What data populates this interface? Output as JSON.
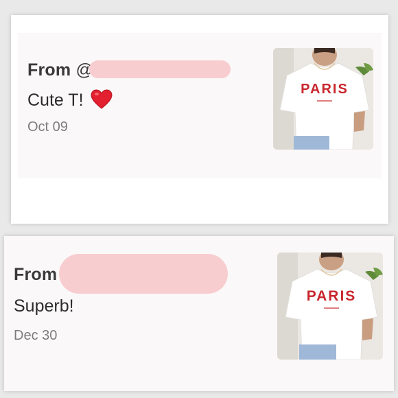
{
  "reviews": [
    {
      "from_label": "From",
      "handle_visible": "@",
      "message": "Cute T!",
      "emoji": "heart-emoji",
      "date": "Oct 09",
      "image": {
        "shirt_text": "PARIS",
        "shirt_color": "#ffffff",
        "text_color": "#c8262c"
      }
    },
    {
      "from_label": "From",
      "message": "Superb!",
      "date": "Dec 30",
      "image": {
        "shirt_text": "PARIS",
        "shirt_color": "#ffffff",
        "text_color": "#c8262c"
      }
    }
  ],
  "colors": {
    "mask": "#f8cdd0",
    "text": "#3a3a3a",
    "date": "#7c7c7c",
    "card_bg": "#fbf8f9"
  }
}
